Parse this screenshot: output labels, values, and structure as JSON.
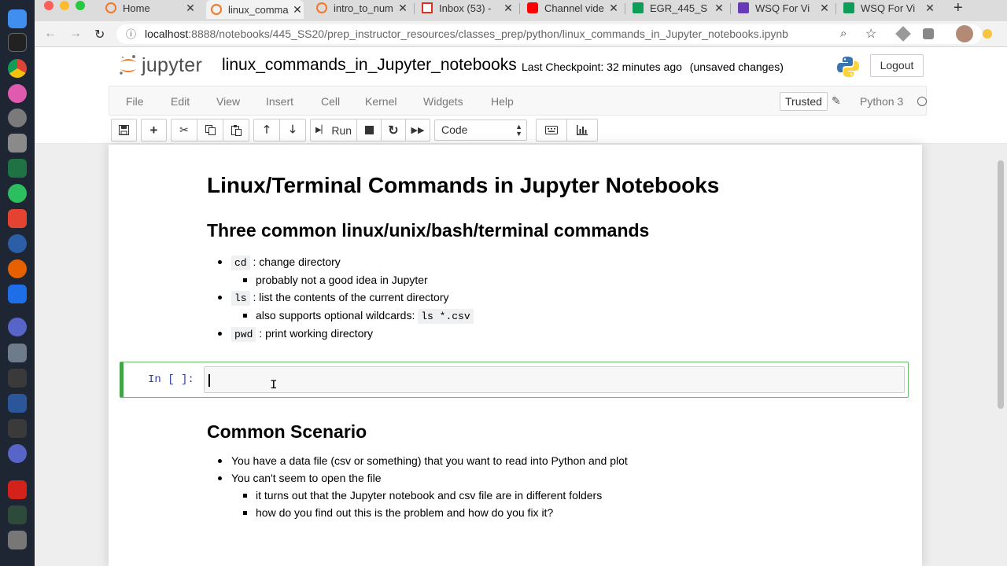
{
  "browser": {
    "tabs": [
      {
        "title": "Home",
        "icon": "jupyter-favicon"
      },
      {
        "title": "linux_comma",
        "icon": "jupyter-favicon",
        "active": true
      },
      {
        "title": "intro_to_num",
        "icon": "jupyter-favicon"
      },
      {
        "title": "Inbox (53) -",
        "icon": "gmail-favicon"
      },
      {
        "title": "Channel vide",
        "icon": "youtube-favicon"
      },
      {
        "title": "EGR_445_S",
        "icon": "sheets-favicon"
      },
      {
        "title": "WSQ For Vi",
        "icon": "forms-favicon"
      },
      {
        "title": "WSQ For Vi",
        "icon": "sheets-favicon"
      }
    ],
    "url_host": "localhost",
    "url_path": ":8888/notebooks/445_SS20/prep_instructor_resources/classes_prep/python/linux_commands_in_Jupyter_notebooks.ipynb"
  },
  "jupyter": {
    "logo_text": "jupyter",
    "notebook_name": "linux_commands_in_Jupyter_notebooks",
    "checkpoint": "Last Checkpoint: 32 minutes ago",
    "unsaved": "(unsaved changes)",
    "logout": "Logout",
    "menu": [
      "File",
      "Edit",
      "View",
      "Insert",
      "Cell",
      "Kernel",
      "Widgets",
      "Help"
    ],
    "trusted": "Trusted",
    "kernel_name": "Python 3",
    "run_label": "Run",
    "cell_type": "Code"
  },
  "notebook": {
    "title": "Linux/Terminal Commands in Jupyter Notebooks",
    "section1": "Three common linux/unix/bash/terminal commands",
    "cmd_cd": "cd",
    "cmd_cd_desc": ": change directory",
    "cmd_cd_sub": "probably not a good idea in Jupyter",
    "cmd_ls": "ls",
    "cmd_ls_desc": ": list the contents of the current directory",
    "cmd_ls_sub": "also supports optional wildcards:",
    "cmd_ls_sub_code": "ls *.csv",
    "cmd_pwd": "pwd",
    "cmd_pwd_desc": ": print working directory",
    "prompt": "In [ ]:",
    "section2": "Common Scenario",
    "scenario_1": "You have a data file (csv or something) that you want to read into Python and plot",
    "scenario_2": "You can't seem to open the file",
    "scenario_2a": "it turns out that the Jupyter notebook and csv file are in different folders",
    "scenario_2b": "how do you find out this is the problem and how do you fix it?"
  },
  "colors": {
    "jupyter_orange": "#f37726",
    "cell_selected_border": "#42a548",
    "prompt_blue": "#303f9f"
  }
}
